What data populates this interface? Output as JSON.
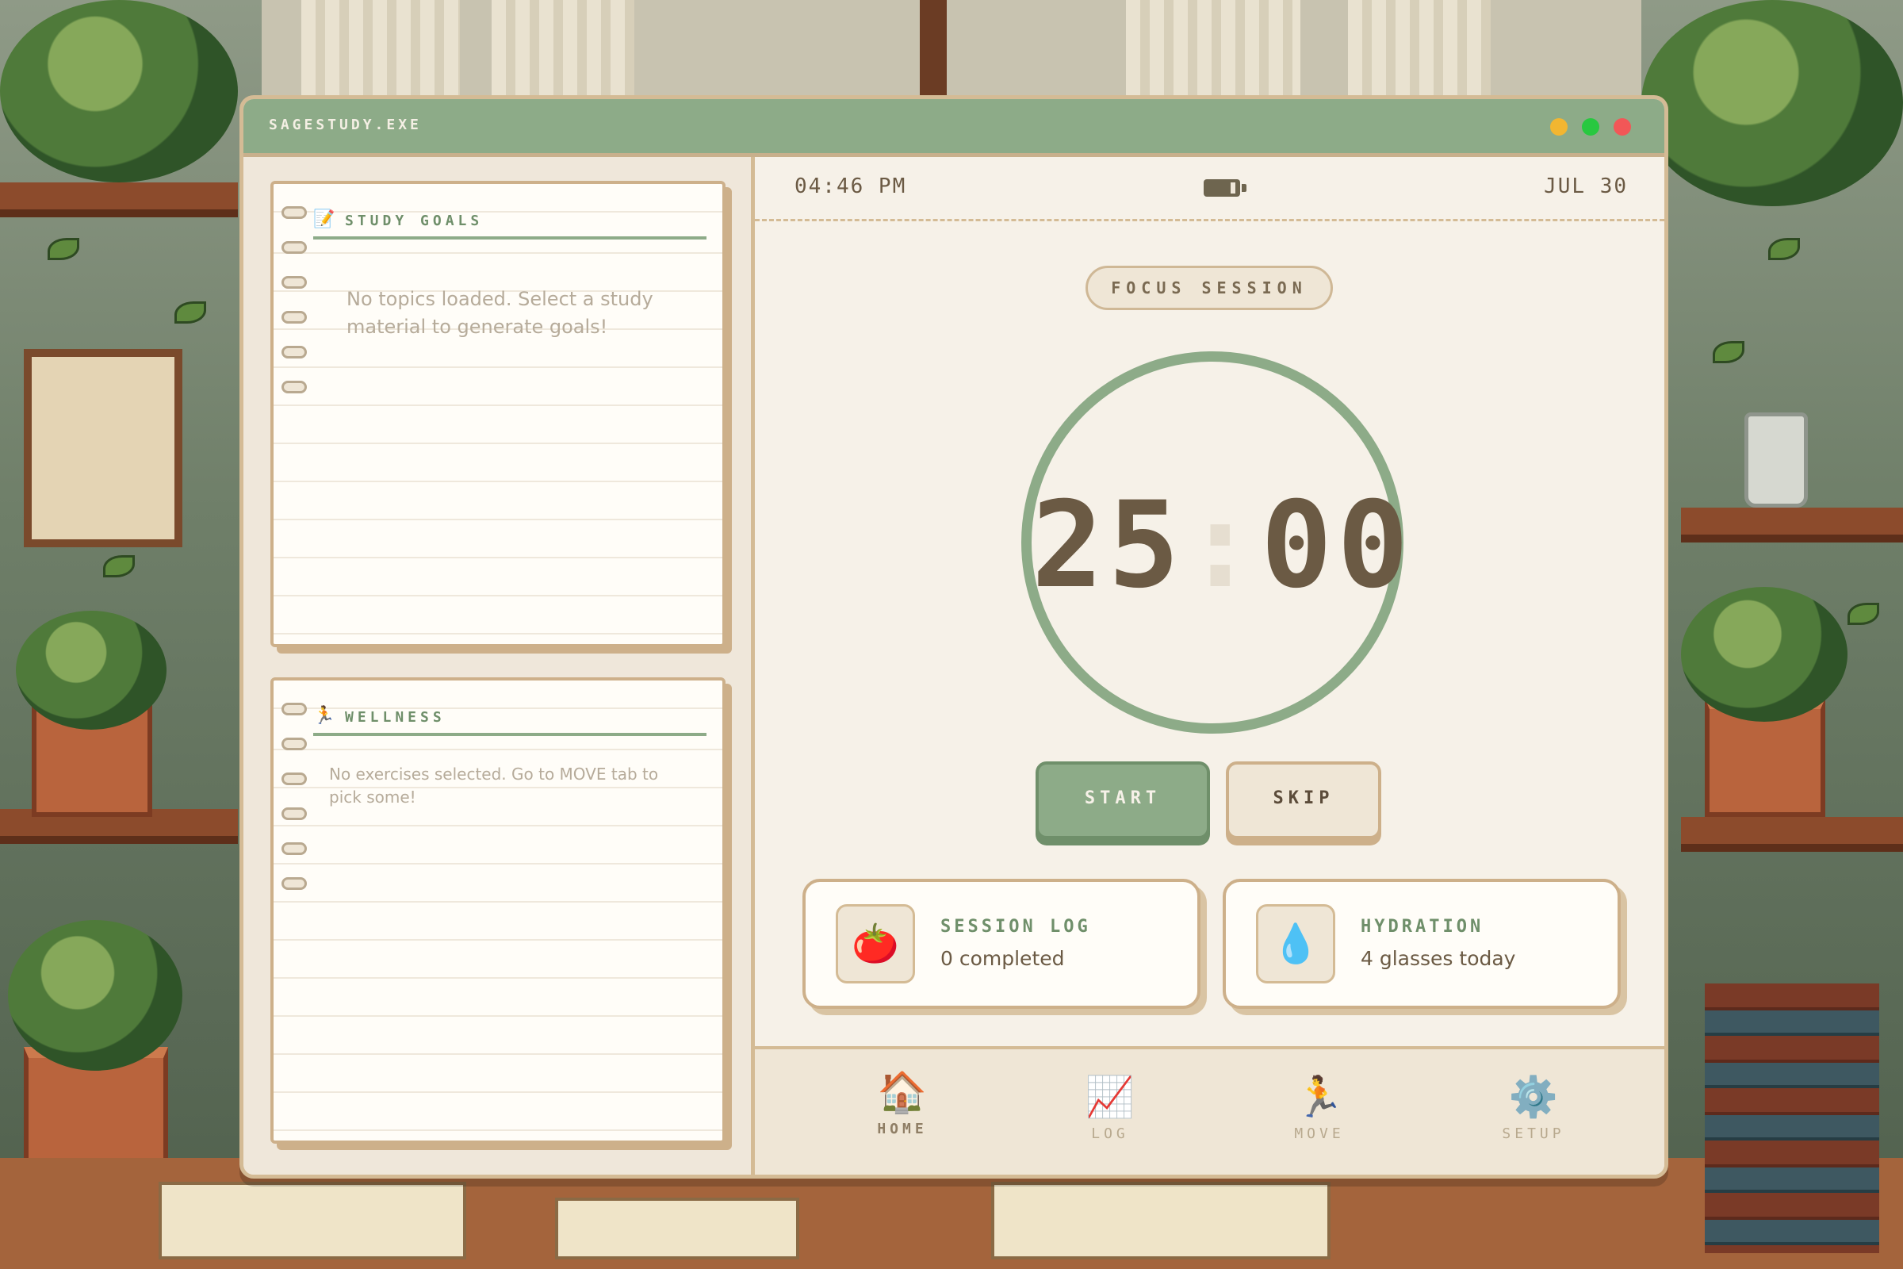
{
  "window": {
    "title": "SAGESTUDY.EXE"
  },
  "study_goals": {
    "icon": "📝",
    "heading": "STUDY GOALS",
    "empty_message": "No topics loaded. Select a study material to generate goals!"
  },
  "wellness": {
    "icon": "🏃",
    "heading": "WELLNESS",
    "empty_message": "No exercises selected. Go to MOVE tab to pick some!"
  },
  "status": {
    "time": "04:46 PM",
    "date": "JUL 30"
  },
  "timer": {
    "mode_label": "FOCUS SESSION",
    "minutes": "25",
    "separator": ":",
    "seconds": "00"
  },
  "controls": {
    "start_label": "START",
    "skip_label": "SKIP"
  },
  "cards": {
    "session_log": {
      "icon": "🍅",
      "title": "SESSION LOG",
      "value": "0 completed"
    },
    "hydration": {
      "icon": "💧",
      "title": "HYDRATION",
      "value": "4 glasses today"
    }
  },
  "nav": {
    "items": [
      {
        "icon": "🏠",
        "label": "HOME"
      },
      {
        "icon": "📈",
        "label": "LOG"
      },
      {
        "icon": "🏃",
        "label": "MOVE"
      },
      {
        "icon": "⚙️",
        "label": "SETUP"
      }
    ],
    "active": "HOME"
  },
  "colors": {
    "accent": "#8dab88",
    "titlebar": "#8dab88",
    "panel": "#efe7da",
    "text": "#6b5a44",
    "border": "#d4bb95"
  }
}
